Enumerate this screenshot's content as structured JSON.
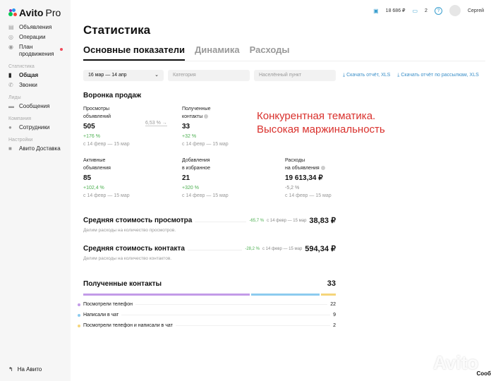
{
  "brand": {
    "name": "Avito",
    "suffix": "Pro"
  },
  "sidebar": {
    "items": [
      {
        "label": "Объявления",
        "icon": "list-icon"
      },
      {
        "label": "Операции",
        "icon": "ruble-circle-icon"
      },
      {
        "label": "План продвижения",
        "icon": "eye-icon"
      }
    ],
    "sections": [
      {
        "title": "Статистика",
        "items": [
          {
            "label": "Общая",
            "icon": "bar-chart-icon",
            "active": true
          },
          {
            "label": "Звонки",
            "icon": "phone-icon"
          }
        ]
      },
      {
        "title": "Лиды",
        "items": [
          {
            "label": "Сообщения",
            "icon": "chat-icon"
          }
        ]
      },
      {
        "title": "Компания",
        "items": [
          {
            "label": "Сотрудники",
            "icon": "user-icon"
          }
        ]
      },
      {
        "title": "Настройки",
        "items": [
          {
            "label": "Авито Доставка",
            "icon": "truck-icon"
          }
        ]
      }
    ],
    "bottom": "На Авито"
  },
  "topbar": {
    "balance": "18 686 ₽",
    "bonus": "2",
    "user": "Сергей"
  },
  "page": {
    "title": "Статистика",
    "tabs": [
      "Основные показатели",
      "Динамика",
      "Расходы"
    ]
  },
  "filters": {
    "date": "16 мар — 14 апр",
    "category": "Категория",
    "city": "Населённый пункт",
    "download1": "Скачать отчёт, XLS",
    "download2": "Скачать отчёт по рассылкам, XLS"
  },
  "funnel": {
    "title": "Воронка продаж",
    "conversion": "6,53 %",
    "note": "Конкурентная тематика.\nВысокая маржинальность",
    "metrics": [
      {
        "l1": "Просмотры",
        "l2": "объявлений",
        "value": "505",
        "change": "+176 %",
        "period": "с 14 февр — 15 мар"
      },
      {
        "l1": "Полученные",
        "l2": "контакты",
        "value": "33",
        "change": "+32 %",
        "period": "с 14 февр — 15 мар"
      },
      {
        "l1": "Активные",
        "l2": "объявления",
        "value": "85",
        "change": "+102,4 %",
        "period": "с 14 февр — 15 мар"
      },
      {
        "l1": "Добавления",
        "l2": "в избранное",
        "value": "21",
        "change": "+320 %",
        "period": "с 14 февр — 15 мар"
      },
      {
        "l1": "Расходы",
        "l2": "на объявления",
        "value": "19 613,34 ₽",
        "change": "-5,2 %",
        "period": "с 14 февр — 15 мар"
      }
    ]
  },
  "costs": [
    {
      "title": "Средняя стоимость просмотра",
      "change": "-65,7 %",
      "period": "с 14 февр — 15 мар",
      "value": "38,83 ₽",
      "desc": "Делим расходы на количество просмотров."
    },
    {
      "title": "Средняя стоимость контакта",
      "change": "-28,2 %",
      "period": "с 14 февр — 15 мар",
      "value": "594,34 ₽",
      "desc": "Делим расходы на количество контактов."
    }
  ],
  "contacts": {
    "title": "Полученные контакты",
    "total": "33",
    "items": [
      {
        "label": "Посмотрели телефон",
        "value": "22",
        "color": "#c39be8"
      },
      {
        "label": "Написали в чат",
        "value": "9",
        "color": "#8ccbef"
      },
      {
        "label": "Посмотрели телефон и написали в чат",
        "value": "2",
        "color": "#f5d57a"
      }
    ]
  },
  "watermark": "Avito",
  "cut_text": "Сооб"
}
